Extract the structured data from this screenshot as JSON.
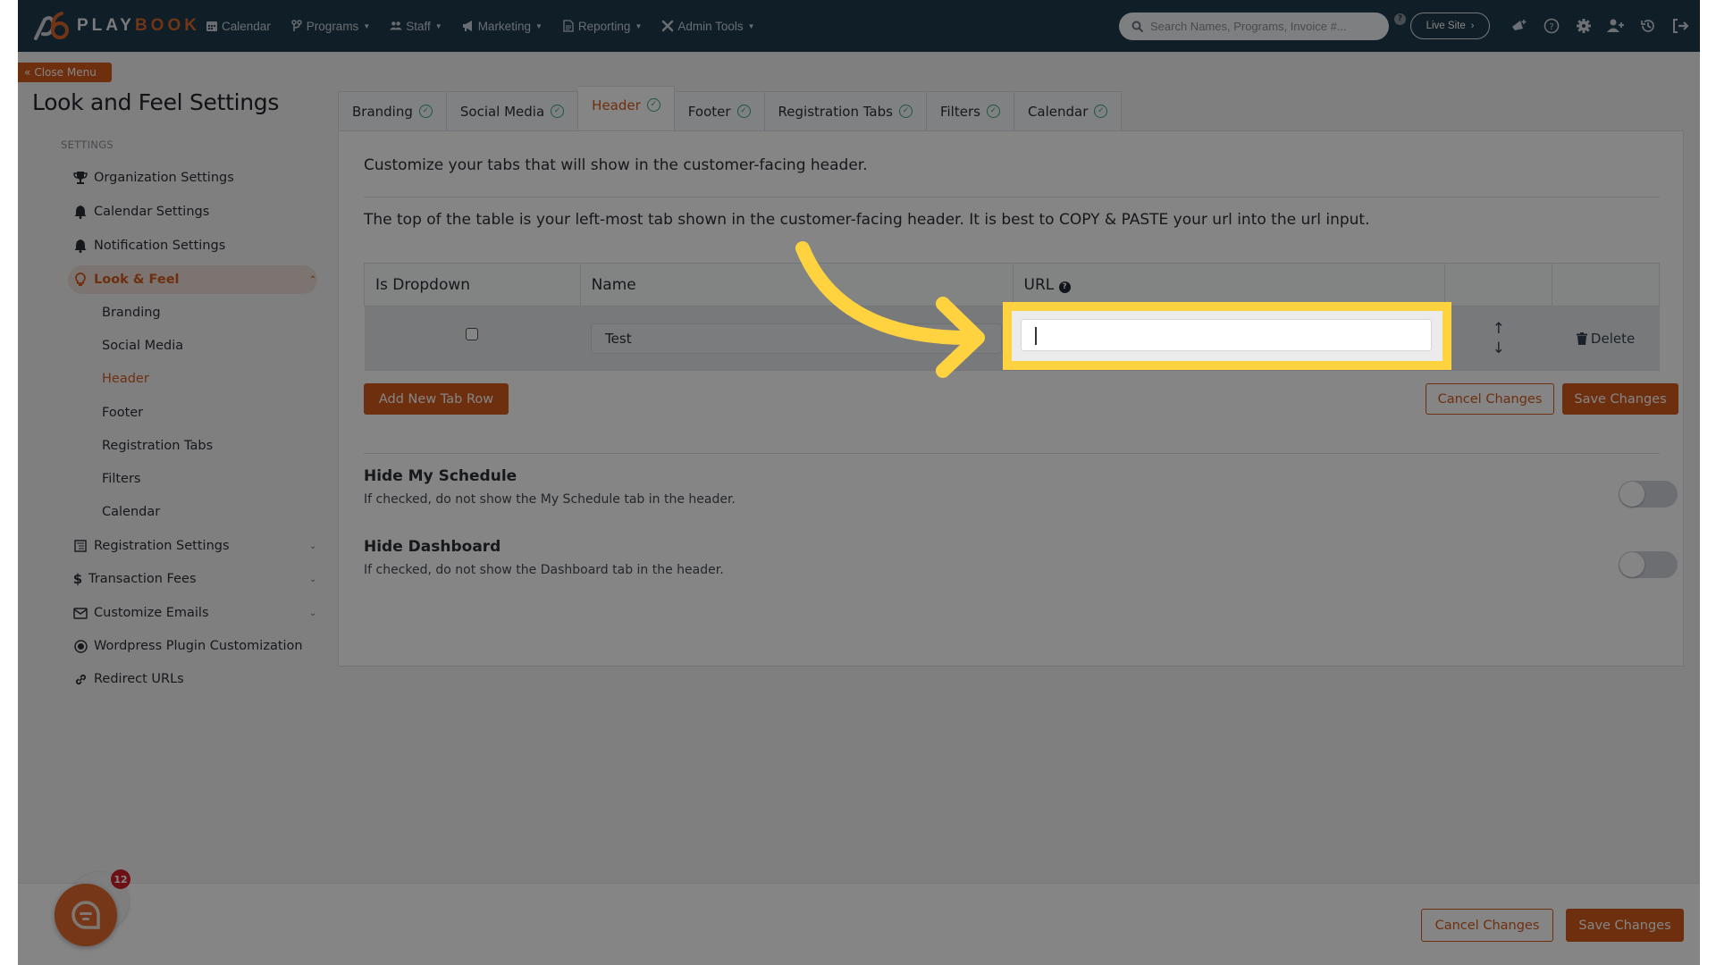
{
  "app": {
    "logo_part1": "PLAY",
    "logo_part2": "BOOK",
    "brand_color": "#d35a1e"
  },
  "topnav": {
    "items": [
      {
        "label": "Calendar",
        "icon": "calendar-icon",
        "has_caret": false
      },
      {
        "label": "Programs",
        "icon": "branch-icon",
        "has_caret": true
      },
      {
        "label": "Staff",
        "icon": "users-icon",
        "has_caret": true
      },
      {
        "label": "Marketing",
        "icon": "megaphone-icon",
        "has_caret": true
      },
      {
        "label": "Reporting",
        "icon": "file-icon",
        "has_caret": true
      },
      {
        "label": "Admin Tools",
        "icon": "tools-icon",
        "has_caret": true
      }
    ],
    "search_placeholder": "Search Names, Programs, Invoice #...",
    "search_help": "?",
    "live_site_label": "Live Site",
    "right_icons": [
      "megaphone-plus-icon",
      "help-circle-icon",
      "gear-icon",
      "user-plus-icon",
      "history-icon",
      "logout-icon"
    ]
  },
  "sidebar": {
    "close_menu_label": "Close Menu",
    "page_title": "Look and Feel Settings",
    "section_label": "SETTINGS",
    "items": [
      {
        "label": "Organization Settings",
        "icon": "trophy-icon"
      },
      {
        "label": "Calendar Settings",
        "icon": "bell-icon"
      },
      {
        "label": "Notification Settings",
        "icon": "bell-icon"
      },
      {
        "label": "Look & Feel",
        "icon": "lightbulb-icon",
        "active": true,
        "expanded": true
      },
      {
        "label": "Registration Settings",
        "icon": "registration-icon",
        "has_chevron": true
      },
      {
        "label": "Transaction Fees",
        "icon": "dollar-icon",
        "has_chevron": true
      },
      {
        "label": "Customize Emails",
        "icon": "envelope-icon",
        "has_chevron": true
      },
      {
        "label": "Wordpress Plugin Customization",
        "icon": "wordpress-icon"
      },
      {
        "label": "Redirect URLs",
        "icon": "link-icon"
      }
    ],
    "subitems": [
      {
        "label": "Branding"
      },
      {
        "label": "Social Media"
      },
      {
        "label": "Header",
        "active": true
      },
      {
        "label": "Footer"
      },
      {
        "label": "Registration Tabs"
      },
      {
        "label": "Filters"
      },
      {
        "label": "Calendar"
      }
    ]
  },
  "tabs": [
    {
      "label": "Branding",
      "complete": true
    },
    {
      "label": "Social Media",
      "complete": true
    },
    {
      "label": "Header",
      "complete": true,
      "active": true
    },
    {
      "label": "Footer",
      "complete": true
    },
    {
      "label": "Registration Tabs",
      "complete": true
    },
    {
      "label": "Filters",
      "complete": true
    },
    {
      "label": "Calendar",
      "complete": true
    }
  ],
  "main": {
    "intro": "Customize your tabs that will show in the customer-facing header.",
    "instructions": "The top of the table is your left-most tab shown in the customer-facing header. It is best to COPY & PASTE your url into the url input.",
    "table": {
      "columns": [
        "Is Dropdown",
        "Name",
        "URL",
        "",
        ""
      ],
      "url_help": "?",
      "rows": [
        {
          "is_dropdown": false,
          "name": "Test",
          "url": "",
          "delete_label": "Delete"
        }
      ]
    },
    "add_row_label": "Add New Tab Row",
    "cancel_label": "Cancel Changes",
    "save_label": "Save Changes",
    "options": [
      {
        "title": "Hide My Schedule",
        "description": "If checked, do not show the My Schedule tab in the header.",
        "enabled": false
      },
      {
        "title": "Hide Dashboard",
        "description": "If checked, do not show the Dashboard tab in the header.",
        "enabled": false
      }
    ]
  },
  "footer": {
    "cancel_label": "Cancel Changes",
    "save_label": "Save Changes"
  },
  "chat": {
    "badge_count": "12"
  },
  "annotation": {
    "highlight_color": "#ffd23f",
    "target": "url-input"
  }
}
